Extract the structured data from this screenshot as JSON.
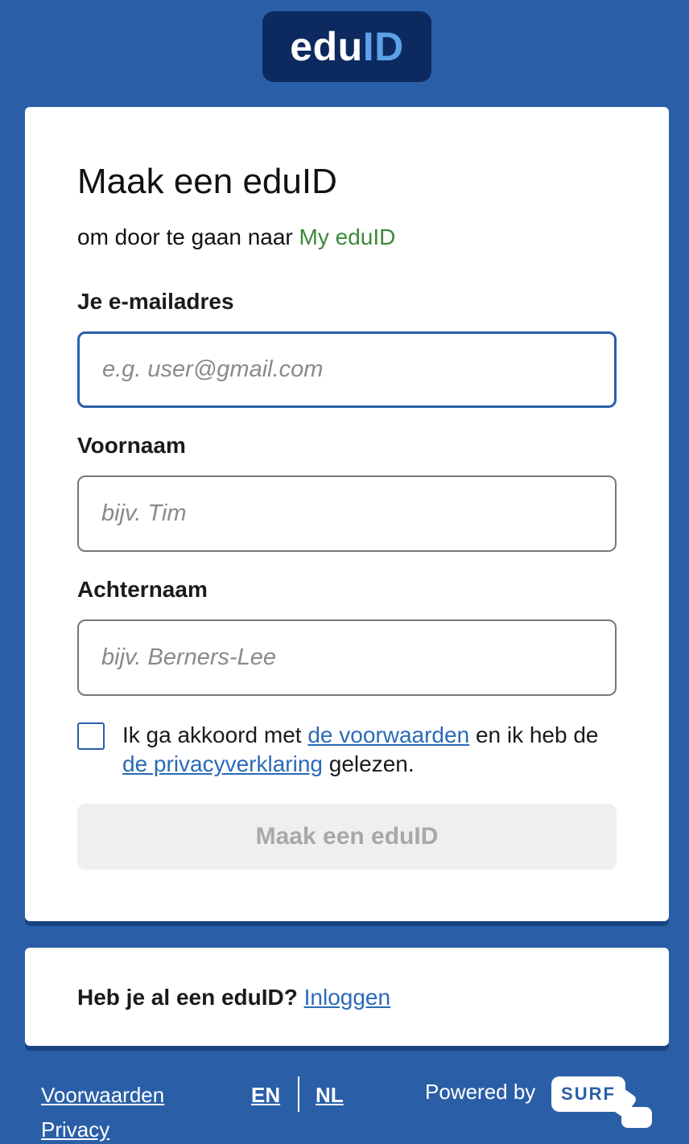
{
  "logo": {
    "edu": "edu",
    "id": "ID"
  },
  "form": {
    "title": "Maak een eduID",
    "subtitle_prefix": "om door te gaan naar",
    "subtitle_app": "My eduID",
    "email": {
      "label": "Je e-mailadres",
      "placeholder": "e.g. user@gmail.com",
      "value": ""
    },
    "firstname": {
      "label": "Voornaam",
      "placeholder": "bijv. Tim",
      "value": ""
    },
    "lastname": {
      "label": "Achternaam",
      "placeholder": "bijv. Berners-Lee",
      "value": ""
    },
    "consent": {
      "checked": false,
      "text_1": "Ik ga akkoord met",
      "terms_link": "de voorwaarden",
      "text_2": "en ik heb de",
      "privacy_link": "de privacyverklaring",
      "text_3": "gelezen."
    },
    "submit_label": "Maak een eduID",
    "submit_disabled": true
  },
  "login": {
    "prompt": "Heb je al een eduID?",
    "link": "Inloggen"
  },
  "footer": {
    "terms": "Voorwaarden",
    "privacy": "Privacy",
    "languages": [
      "EN",
      "NL"
    ],
    "powered_by": "Powered by",
    "surf_logo": "SURF"
  },
  "colors": {
    "background": "#2a5fa8",
    "logo_bg": "#0c2960",
    "link": "#2a6bb8",
    "app_name": "#3a8a3a",
    "focus_border": "#2a5fa8"
  }
}
